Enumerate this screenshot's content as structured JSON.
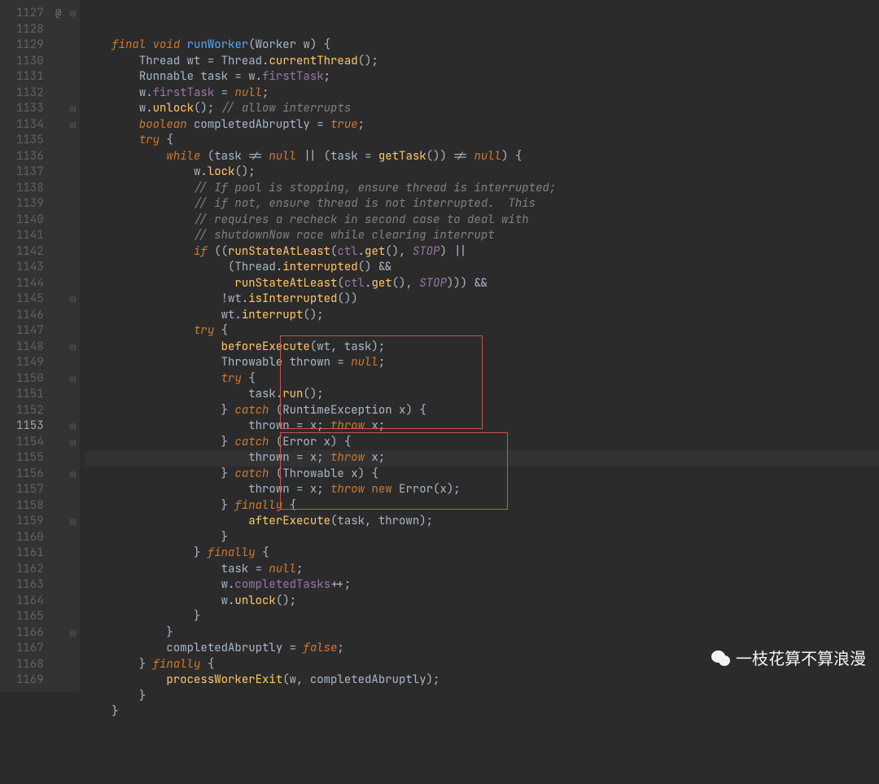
{
  "startLine": 1127,
  "highlightedLine": 1153,
  "overrideIconLine": 1127,
  "overrideIconChar": "@",
  "foldMarkers": [
    1127,
    1133,
    1134,
    1145,
    1148,
    1150,
    1153,
    1154,
    1156,
    1159,
    1166
  ],
  "watermark": "一枝花算不算浪漫",
  "highlightBoxes": [
    {
      "top_line": 1148,
      "height_lines": 6
    },
    {
      "top_line": 1154,
      "height_lines": 5
    }
  ],
  "code": [
    {
      "indent": 1,
      "t": [
        [
          "kw",
          "final"
        ],
        [
          "p",
          " "
        ],
        [
          "kw",
          "void"
        ],
        [
          "p",
          " "
        ],
        [
          "mthd",
          "runWorker"
        ],
        [
          "p",
          "("
        ],
        [
          "typ",
          "Worker"
        ],
        [
          "p",
          " w) {"
        ]
      ]
    },
    {
      "indent": 2,
      "t": [
        [
          "typ",
          "Thread"
        ],
        [
          "p",
          " wt = "
        ],
        [
          "typ",
          "Thread"
        ],
        [
          "p",
          "."
        ],
        [
          "mth",
          "currentThread"
        ],
        [
          "p",
          "();"
        ]
      ]
    },
    {
      "indent": 2,
      "t": [
        [
          "typ",
          "Runnable"
        ],
        [
          "p",
          " task = w."
        ],
        [
          "fld",
          "firstTask"
        ],
        [
          "p",
          ";"
        ]
      ]
    },
    {
      "indent": 2,
      "t": [
        [
          "p",
          "w."
        ],
        [
          "fld",
          "firstTask"
        ],
        [
          "p",
          " = "
        ],
        [
          "nul",
          "null"
        ],
        [
          "p",
          ";"
        ]
      ]
    },
    {
      "indent": 2,
      "t": [
        [
          "p",
          "w."
        ],
        [
          "mth",
          "unlock"
        ],
        [
          "p",
          "(); "
        ],
        [
          "cmt",
          "// allow interrupts"
        ]
      ]
    },
    {
      "indent": 2,
      "t": [
        [
          "kw",
          "boolean"
        ],
        [
          "p",
          " completedAbruptly = "
        ],
        [
          "bool",
          "true"
        ],
        [
          "p",
          ";"
        ]
      ]
    },
    {
      "indent": 2,
      "t": [
        [
          "kw",
          "try"
        ],
        [
          "p",
          " {"
        ]
      ]
    },
    {
      "indent": 3,
      "t": [
        [
          "kw",
          "while"
        ],
        [
          "p",
          " (task != "
        ],
        [
          "nul",
          "null"
        ],
        [
          "p",
          " || (task = "
        ],
        [
          "mth",
          "getTask"
        ],
        [
          "p",
          "()) != "
        ],
        [
          "nul",
          "null"
        ],
        [
          "p",
          ") {"
        ]
      ]
    },
    {
      "indent": 4,
      "t": [
        [
          "p",
          "w."
        ],
        [
          "mth",
          "lock"
        ],
        [
          "p",
          "();"
        ]
      ]
    },
    {
      "indent": 4,
      "t": [
        [
          "cmt",
          "// If pool is stopping, ensure thread is interrupted;"
        ]
      ]
    },
    {
      "indent": 4,
      "t": [
        [
          "cmt",
          "// if not, ensure thread is not interrupted.  This"
        ]
      ]
    },
    {
      "indent": 4,
      "t": [
        [
          "cmt",
          "// requires a recheck in second case to deal with"
        ]
      ]
    },
    {
      "indent": 4,
      "t": [
        [
          "cmt",
          "// shutdownNow race while clearing interrupt"
        ]
      ]
    },
    {
      "indent": 4,
      "t": [
        [
          "kw",
          "if"
        ],
        [
          "p",
          " (("
        ],
        [
          "mth",
          "runStateAtLeast"
        ],
        [
          "p",
          "("
        ],
        [
          "fld",
          "ctl"
        ],
        [
          "p",
          "."
        ],
        [
          "mth",
          "get"
        ],
        [
          "p",
          "(), "
        ],
        [
          "con",
          "STOP"
        ],
        [
          "p",
          ") ||"
        ]
      ]
    },
    {
      "indent": 5,
      "t": [
        [
          "p",
          " ("
        ],
        [
          "typ",
          "Thread"
        ],
        [
          "p",
          "."
        ],
        [
          "mth",
          "interrupted"
        ],
        [
          "p",
          "() &&"
        ]
      ]
    },
    {
      "indent": 5,
      "t": [
        [
          "p",
          "  "
        ],
        [
          "mth",
          "runStateAtLeast"
        ],
        [
          "p",
          "("
        ],
        [
          "fld",
          "ctl"
        ],
        [
          "p",
          "."
        ],
        [
          "mth",
          "get"
        ],
        [
          "p",
          "(), "
        ],
        [
          "con",
          "STOP"
        ],
        [
          "p",
          "))) &&"
        ]
      ]
    },
    {
      "indent": 5,
      "t": [
        [
          "p",
          "!wt."
        ],
        [
          "mth",
          "isInterrupted"
        ],
        [
          "p",
          "())"
        ]
      ]
    },
    {
      "indent": 5,
      "t": [
        [
          "p",
          "wt."
        ],
        [
          "mth",
          "interrupt"
        ],
        [
          "p",
          "();"
        ]
      ]
    },
    {
      "indent": 4,
      "t": [
        [
          "kw",
          "try"
        ],
        [
          "p",
          " {"
        ]
      ]
    },
    {
      "indent": 5,
      "t": [
        [
          "mth",
          "beforeExecute"
        ],
        [
          "p",
          "(wt, task);"
        ]
      ]
    },
    {
      "indent": 5,
      "t": [
        [
          "typ",
          "Throwable"
        ],
        [
          "p",
          " thrown = "
        ],
        [
          "nul",
          "null"
        ],
        [
          "p",
          ";"
        ]
      ]
    },
    {
      "indent": 5,
      "t": [
        [
          "kw",
          "try"
        ],
        [
          "p",
          " {"
        ]
      ]
    },
    {
      "indent": 6,
      "t": [
        [
          "p",
          "task."
        ],
        [
          "mth",
          "run"
        ],
        [
          "p",
          "();"
        ]
      ]
    },
    {
      "indent": 5,
      "t": [
        [
          "p",
          "} "
        ],
        [
          "kw",
          "catch"
        ],
        [
          "p",
          " ("
        ],
        [
          "typ",
          "RuntimeException"
        ],
        [
          "p",
          " x) {"
        ]
      ]
    },
    {
      "indent": 6,
      "t": [
        [
          "p",
          "thrown = x; "
        ],
        [
          "kw",
          "throw"
        ],
        [
          "p",
          " x;"
        ]
      ]
    },
    {
      "indent": 5,
      "t": [
        [
          "p",
          "} "
        ],
        [
          "kw",
          "catch"
        ],
        [
          "p",
          " ("
        ],
        [
          "typ",
          "Error"
        ],
        [
          "p",
          " x) {"
        ]
      ]
    },
    {
      "indent": 6,
      "t": [
        [
          "p",
          "thrown = x; "
        ],
        [
          "kw",
          "throw"
        ],
        [
          "p",
          " x;"
        ]
      ]
    },
    {
      "indent": 5,
      "t": [
        [
          "p",
          "} "
        ],
        [
          "kw",
          "catch"
        ],
        [
          "p",
          " ("
        ],
        [
          "typ",
          "Throwable"
        ],
        [
          "p",
          " x) {"
        ]
      ]
    },
    {
      "indent": 6,
      "t": [
        [
          "p",
          "thrown = x; "
        ],
        [
          "kw",
          "throw"
        ],
        [
          "p",
          " "
        ],
        [
          "kw2",
          "new"
        ],
        [
          "p",
          " "
        ],
        [
          "typ",
          "Error"
        ],
        [
          "p",
          "(x);"
        ]
      ]
    },
    {
      "indent": 5,
      "t": [
        [
          "p",
          "} "
        ],
        [
          "kw",
          "finally"
        ],
        [
          "p",
          " {"
        ]
      ]
    },
    {
      "indent": 6,
      "t": [
        [
          "mth",
          "afterExecute"
        ],
        [
          "p",
          "(task, thrown);"
        ]
      ]
    },
    {
      "indent": 5,
      "t": [
        [
          "p",
          "}"
        ]
      ]
    },
    {
      "indent": 4,
      "t": [
        [
          "p",
          "} "
        ],
        [
          "kw",
          "finally"
        ],
        [
          "p",
          " {"
        ]
      ]
    },
    {
      "indent": 5,
      "t": [
        [
          "p",
          "task = "
        ],
        [
          "nul",
          "null"
        ],
        [
          "p",
          ";"
        ]
      ]
    },
    {
      "indent": 5,
      "t": [
        [
          "p",
          "w."
        ],
        [
          "fld",
          "completedTasks"
        ],
        [
          "p",
          "++;"
        ]
      ]
    },
    {
      "indent": 5,
      "t": [
        [
          "p",
          "w."
        ],
        [
          "mth",
          "unlock"
        ],
        [
          "p",
          "();"
        ]
      ]
    },
    {
      "indent": 4,
      "t": [
        [
          "p",
          "}"
        ]
      ]
    },
    {
      "indent": 3,
      "t": [
        [
          "p",
          "}"
        ]
      ]
    },
    {
      "indent": 3,
      "t": [
        [
          "p",
          "completedAbruptly = "
        ],
        [
          "bool",
          "false"
        ],
        [
          "p",
          ";"
        ]
      ]
    },
    {
      "indent": 2,
      "t": [
        [
          "p",
          "} "
        ],
        [
          "kw",
          "finally"
        ],
        [
          "p",
          " {"
        ]
      ]
    },
    {
      "indent": 3,
      "t": [
        [
          "mth",
          "processWorkerExit"
        ],
        [
          "p",
          "(w, completedAbruptly);"
        ]
      ]
    },
    {
      "indent": 2,
      "t": [
        [
          "p",
          "}"
        ]
      ]
    },
    {
      "indent": 1,
      "t": [
        [
          "p",
          "}"
        ]
      ]
    }
  ]
}
